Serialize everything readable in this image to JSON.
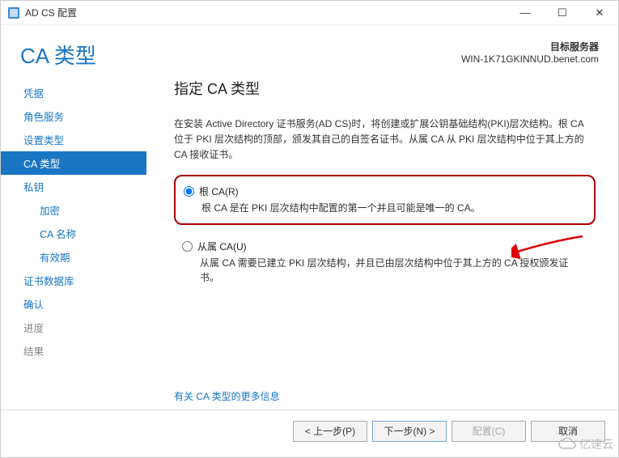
{
  "window": {
    "title": "AD CS 配置",
    "min": "—",
    "max": "☐",
    "close": "✕"
  },
  "header": {
    "page_title": "CA 类型",
    "target_label": "目标服务器",
    "target_value": "WIN-1K71GKINNUD.benet.com"
  },
  "nav": {
    "items": [
      {
        "label": "凭据",
        "enabled": true
      },
      {
        "label": "角色服务",
        "enabled": true
      },
      {
        "label": "设置类型",
        "enabled": true
      },
      {
        "label": "CA 类型",
        "enabled": true,
        "active": true
      },
      {
        "label": "私钥",
        "enabled": true
      },
      {
        "label": "加密",
        "enabled": true,
        "sub": true
      },
      {
        "label": "CA 名称",
        "enabled": true,
        "sub": true
      },
      {
        "label": "有效期",
        "enabled": true,
        "sub": true
      },
      {
        "label": "证书数据库",
        "enabled": true
      },
      {
        "label": "确认",
        "enabled": true
      },
      {
        "label": "进度",
        "enabled": false
      },
      {
        "label": "结果",
        "enabled": false
      }
    ]
  },
  "main": {
    "heading": "指定 CA 类型",
    "description": "在安装 Active Directory 证书服务(AD CS)时，将创建或扩展公钥基础结构(PKI)层次结构。根 CA 位于 PKI 层次结构的顶部，颁发其自己的自签名证书。从属 CA 从 PKI 层次结构中位于其上方的 CA 接收证书。",
    "opt1_label": "根 CA(R)",
    "opt1_desc": "根 CA 是在 PKI 层次结构中配置的第一个并且可能是唯一的 CA。",
    "opt2_label": "从属 CA(U)",
    "opt2_desc": "从属 CA 需要已建立 PKI 层次结构，并且已由层次结构中位于其上方的 CA 授权颁发证书。",
    "more_link": "有关 CA 类型的更多信息"
  },
  "footer": {
    "prev": "< 上一步(P)",
    "next": "下一步(N) >",
    "config": "配置(C)",
    "cancel": "取消"
  },
  "watermark": "亿速云"
}
